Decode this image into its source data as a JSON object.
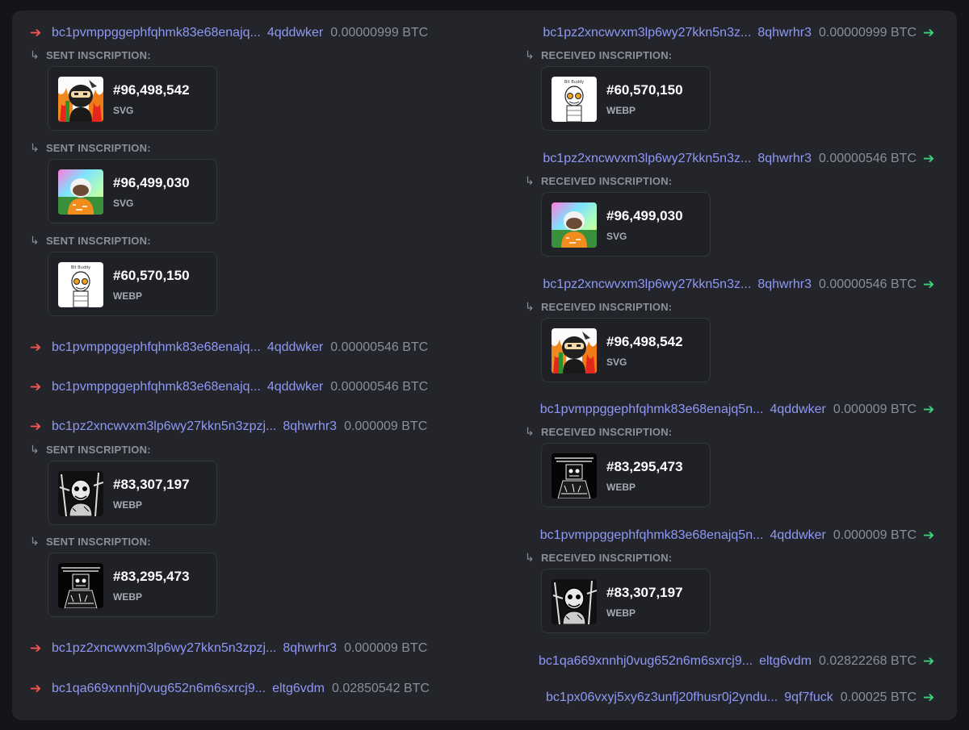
{
  "inputs": [
    {
      "address": "bc1pvmppggephfqhmk83e68enajq...",
      "address_tail": "4qddwker",
      "amount": "0.00000999 BTC",
      "inscriptions": [
        {
          "label": "SENT INSCRIPTION:",
          "number": "#96,498,542",
          "type": "SVG",
          "thumb": "ninja"
        },
        {
          "label": "SENT INSCRIPTION:",
          "number": "#96,499,030",
          "type": "SVG",
          "thumb": "rainbow"
        },
        {
          "label": "SENT INSCRIPTION:",
          "number": "#60,570,150",
          "type": "WEBP",
          "thumb": "sketch"
        }
      ]
    },
    {
      "address": "bc1pvmppggephfqhmk83e68enajq...",
      "address_tail": "4qddwker",
      "amount": "0.00000546 BTC",
      "inscriptions": []
    },
    {
      "address": "bc1pvmppggephfqhmk83e68enajq...",
      "address_tail": "4qddwker",
      "amount": "0.00000546 BTC",
      "inscriptions": []
    },
    {
      "address": "bc1pz2xncwvxm3lp6wy27kkn5n3zpzj...",
      "address_tail": "8qhwrhr3",
      "amount": "0.000009 BTC",
      "inscriptions": [
        {
          "label": "SENT INSCRIPTION:",
          "number": "#83,307,197",
          "type": "WEBP",
          "thumb": "bw-face"
        },
        {
          "label": "SENT INSCRIPTION:",
          "number": "#83,295,473",
          "type": "WEBP",
          "thumb": "bw-dark"
        }
      ]
    },
    {
      "address": "bc1pz2xncwvxm3lp6wy27kkn5n3zpzj...",
      "address_tail": "8qhwrhr3",
      "amount": "0.000009 BTC",
      "inscriptions": []
    },
    {
      "address": "bc1qa669xnnhj0vug652n6m6sxrcj9...",
      "address_tail": "eltg6vdm",
      "amount": "0.02850542 BTC",
      "inscriptions": []
    }
  ],
  "outputs": [
    {
      "address": "bc1pz2xncwvxm3lp6wy27kkn5n3z...",
      "address_tail": "8qhwrhr3",
      "amount": "0.00000999 BTC",
      "inscriptions": [
        {
          "label": "RECEIVED INSCRIPTION:",
          "number": "#60,570,150",
          "type": "WEBP",
          "thumb": "sketch"
        }
      ]
    },
    {
      "address": "bc1pz2xncwvxm3lp6wy27kkn5n3z...",
      "address_tail": "8qhwrhr3",
      "amount": "0.00000546 BTC",
      "inscriptions": [
        {
          "label": "RECEIVED INSCRIPTION:",
          "number": "#96,499,030",
          "type": "SVG",
          "thumb": "rainbow"
        }
      ]
    },
    {
      "address": "bc1pz2xncwvxm3lp6wy27kkn5n3z...",
      "address_tail": "8qhwrhr3",
      "amount": "0.00000546 BTC",
      "inscriptions": [
        {
          "label": "RECEIVED INSCRIPTION:",
          "number": "#96,498,542",
          "type": "SVG",
          "thumb": "ninja"
        }
      ]
    },
    {
      "address": "bc1pvmppggephfqhmk83e68enajq5n...",
      "address_tail": "4qddwker",
      "amount": "0.000009 BTC",
      "inscriptions": [
        {
          "label": "RECEIVED INSCRIPTION:",
          "number": "#83,295,473",
          "type": "WEBP",
          "thumb": "bw-dark"
        }
      ]
    },
    {
      "address": "bc1pvmppggephfqhmk83e68enajq5n...",
      "address_tail": "4qddwker",
      "amount": "0.000009 BTC",
      "inscriptions": [
        {
          "label": "RECEIVED INSCRIPTION:",
          "number": "#83,307,197",
          "type": "WEBP",
          "thumb": "bw-face"
        }
      ]
    },
    {
      "address": "bc1qa669xnnhj0vug652n6m6sxrcj9...",
      "address_tail": "eltg6vdm",
      "amount": "0.02822268 BTC",
      "inscriptions": []
    },
    {
      "address": "bc1px06vxyj5xy6z3unfj20fhusr0j2yndu...",
      "address_tail": "9qf7fuck",
      "amount": "0.00025 BTC",
      "inscriptions": []
    }
  ],
  "icons": {
    "input_arrow": "arrow-right-icon",
    "output_arrow": "arrow-right-icon",
    "inscription_hook": "return-hook-icon"
  },
  "colors": {
    "address": "#8f98f5",
    "sent_arrow": "#f2554f",
    "received_arrow": "#3fd07a",
    "amount": "#8a8e99"
  }
}
